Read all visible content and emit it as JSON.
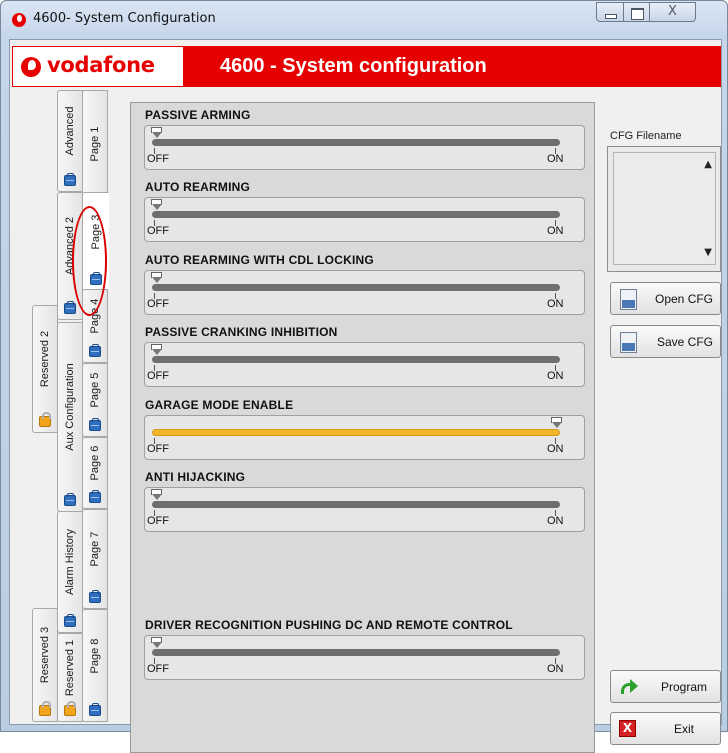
{
  "window": {
    "title": "4600- System Configuration",
    "close_glyph": "X"
  },
  "header": {
    "brand": "vodafone",
    "title": "4600 - System configuration",
    "brand_color": "#e60000"
  },
  "tabs": [
    {
      "id": "page1",
      "label": "Page 1",
      "icon": "briefcase-icon"
    },
    {
      "id": "advanced",
      "label": "Advanced",
      "icon": "briefcase-icon"
    },
    {
      "id": "page3",
      "label": "Page 3",
      "icon": "briefcase-icon",
      "active": true
    },
    {
      "id": "advanced2",
      "label": "Advanced 2",
      "icon": "briefcase-icon"
    },
    {
      "id": "page4",
      "label": "Page 4",
      "icon": "briefcase-icon"
    },
    {
      "id": "reserved2",
      "label": "Reserved 2",
      "icon": "lock-icon"
    },
    {
      "id": "page5",
      "label": "Page 5",
      "icon": "briefcase-icon"
    },
    {
      "id": "auxconfig",
      "label": "Aux Configuration",
      "icon": "briefcase-icon"
    },
    {
      "id": "page6",
      "label": "Page 6",
      "icon": "briefcase-icon"
    },
    {
      "id": "alarmhistory",
      "label": "Alarm History",
      "icon": "briefcase-icon"
    },
    {
      "id": "page7",
      "label": "Page 7",
      "icon": "briefcase-icon"
    },
    {
      "id": "page8",
      "label": "Page 8",
      "icon": "briefcase-icon"
    },
    {
      "id": "reserved1",
      "label": "Reserved 1",
      "icon": "lock-icon"
    },
    {
      "id": "reserved3",
      "label": "Reserved 3",
      "icon": "lock-icon"
    }
  ],
  "settings": [
    {
      "label": "PASSIVE ARMING",
      "value": "OFF",
      "off_label": "OFF",
      "on_label": "ON"
    },
    {
      "label": "AUTO REARMING",
      "value": "OFF",
      "off_label": "OFF",
      "on_label": "ON"
    },
    {
      "label": "AUTO REARMING WITH CDL LOCKING",
      "value": "OFF",
      "off_label": "OFF",
      "on_label": "ON"
    },
    {
      "label": "PASSIVE CRANKING INHIBITION",
      "value": "OFF",
      "off_label": "OFF",
      "on_label": "ON"
    },
    {
      "label": "GARAGE MODE ENABLE",
      "value": "ON",
      "off_label": "OFF",
      "on_label": "ON"
    },
    {
      "label": "ANTI HIJACKING",
      "value": "OFF",
      "off_label": "OFF",
      "on_label": "ON"
    },
    {
      "label": "DRIVER RECOGNITION PUSHING DC AND REMOTE CONTROL",
      "value": "OFF",
      "off_label": "OFF",
      "on_label": "ON"
    }
  ],
  "cfg": {
    "title": "CFG Filename",
    "open_label": "Open CFG",
    "save_label": "Save CFG"
  },
  "actions": {
    "program_label": "Program",
    "exit_label": "Exit",
    "exit_glyph": "X"
  }
}
